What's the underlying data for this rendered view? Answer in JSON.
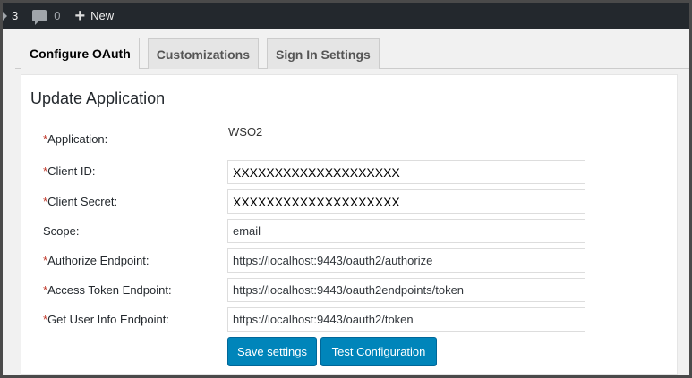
{
  "adminbar": {
    "updates_count": "3",
    "comments_count": "0",
    "new_label": "New"
  },
  "tabs": [
    {
      "label": "Configure OAuth",
      "active": true
    },
    {
      "label": "Customizations",
      "active": false
    },
    {
      "label": "Sign In Settings",
      "active": false
    }
  ],
  "panel": {
    "title": "Update Application",
    "required_mark": "*",
    "application": {
      "label": "Application:",
      "value": "WSO2"
    },
    "fields": [
      {
        "label": "Client ID:",
        "required": true,
        "value": "XXXXXXXXXXXXXXXXXXXX"
      },
      {
        "label": "Client Secret:",
        "required": true,
        "value": "XXXXXXXXXXXXXXXXXXXX"
      },
      {
        "label": "Scope:",
        "required": false,
        "value": "email"
      },
      {
        "label": "Authorize Endpoint:",
        "required": true,
        "value": "https://localhost:9443/oauth2/authorize"
      },
      {
        "label": "Access Token Endpoint:",
        "required": true,
        "value": "https://localhost:9443/oauth2endpoints/token"
      },
      {
        "label": "Get User Info Endpoint:",
        "required": true,
        "value": "https://localhost:9443/oauth2/token"
      }
    ],
    "buttons": {
      "save": "Save settings",
      "test": "Test Configuration"
    }
  },
  "colors": {
    "adminbar_bg": "#23282d",
    "primary_button": "#0085ba",
    "required_mark": "#c0392b"
  }
}
